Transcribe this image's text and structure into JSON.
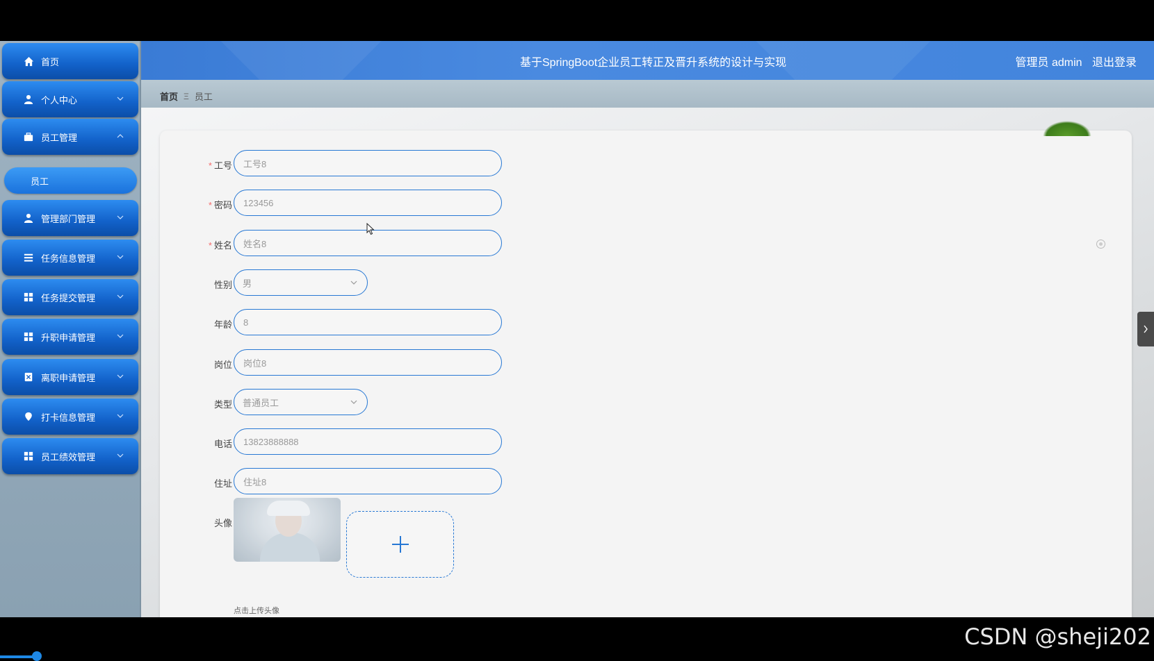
{
  "app": {
    "title": "基于SpringBoot企业员工转正及晋升系统的设计与实现",
    "user_label": "管理员 admin",
    "logout_label": "退出登录"
  },
  "sidebar": {
    "items": [
      {
        "label": "首页",
        "icon": "home-icon"
      },
      {
        "label": "个人中心",
        "icon": "user-icon"
      },
      {
        "label": "员工管理",
        "icon": "briefcase-icon",
        "expanded": true
      },
      {
        "label": "管理部门管理",
        "icon": "user-icon"
      },
      {
        "label": "任务信息管理",
        "icon": "list-icon"
      },
      {
        "label": "任务提交管理",
        "icon": "grid-icon"
      },
      {
        "label": "升职申请管理",
        "icon": "grid-icon"
      },
      {
        "label": "离职申请管理",
        "icon": "document-icon"
      },
      {
        "label": "打卡信息管理",
        "icon": "location-pin-icon"
      },
      {
        "label": "员工绩效管理",
        "icon": "grid-icon"
      }
    ],
    "sub_items": [
      {
        "label": "员工",
        "active": true
      }
    ]
  },
  "breadcrumb": {
    "home": "首页",
    "separator": "Ξ",
    "current": "员工"
  },
  "form": {
    "fields": [
      {
        "label": "工号",
        "required": true,
        "placeholder": "工号8"
      },
      {
        "label": "密码",
        "required": true,
        "placeholder": "123456"
      },
      {
        "label": "姓名",
        "required": true,
        "placeholder": "姓名8"
      },
      {
        "label": "性别",
        "required": false,
        "value": "男",
        "type": "select"
      },
      {
        "label": "年龄",
        "required": false,
        "placeholder": "8"
      },
      {
        "label": "岗位",
        "required": false,
        "placeholder": "岗位8"
      },
      {
        "label": "类型",
        "required": false,
        "value": "普通员工",
        "type": "select"
      },
      {
        "label": "电话",
        "required": false,
        "placeholder": "13823888888"
      },
      {
        "label": "住址",
        "required": false,
        "placeholder": "住址8"
      }
    ],
    "avatar_label": "头像",
    "upload_hint": "点击上传头像",
    "required_mark": "*"
  },
  "watermark": "CSDN @sheji202",
  "colors": {
    "primary": "#2778d4",
    "header": "#3a7bd5",
    "required": "#f56c6c"
  }
}
